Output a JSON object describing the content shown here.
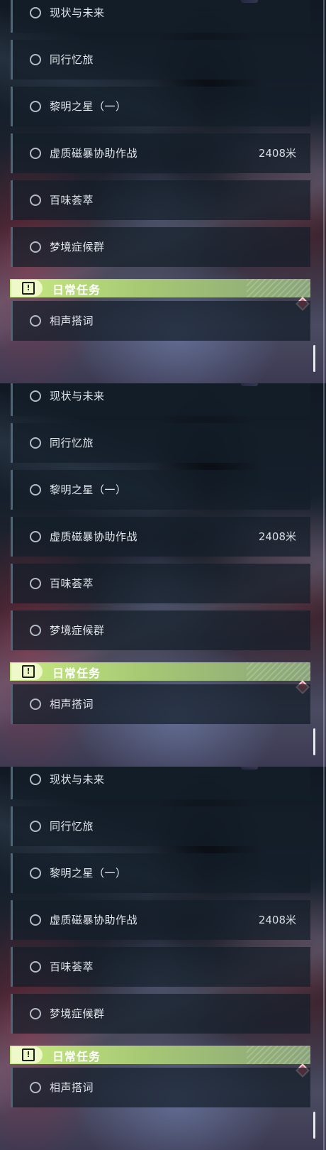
{
  "quest_list": {
    "items": [
      {
        "label": "现状与未来",
        "distance": ""
      },
      {
        "label": "同行忆旅",
        "distance": ""
      },
      {
        "label": "黎明之星（一）",
        "distance": ""
      },
      {
        "label": "虚质磁暴协助作战",
        "distance": "2408米"
      },
      {
        "label": "百味荟萃",
        "distance": ""
      },
      {
        "label": "梦境症候群",
        "distance": ""
      }
    ]
  },
  "daily_section": {
    "title": "日常任务",
    "icon": "exclamation-box-icon",
    "items": [
      {
        "label": "相声搭词"
      }
    ]
  },
  "colors": {
    "header_accent": "#c8ea82",
    "tracker_marker": "#d9566a"
  }
}
